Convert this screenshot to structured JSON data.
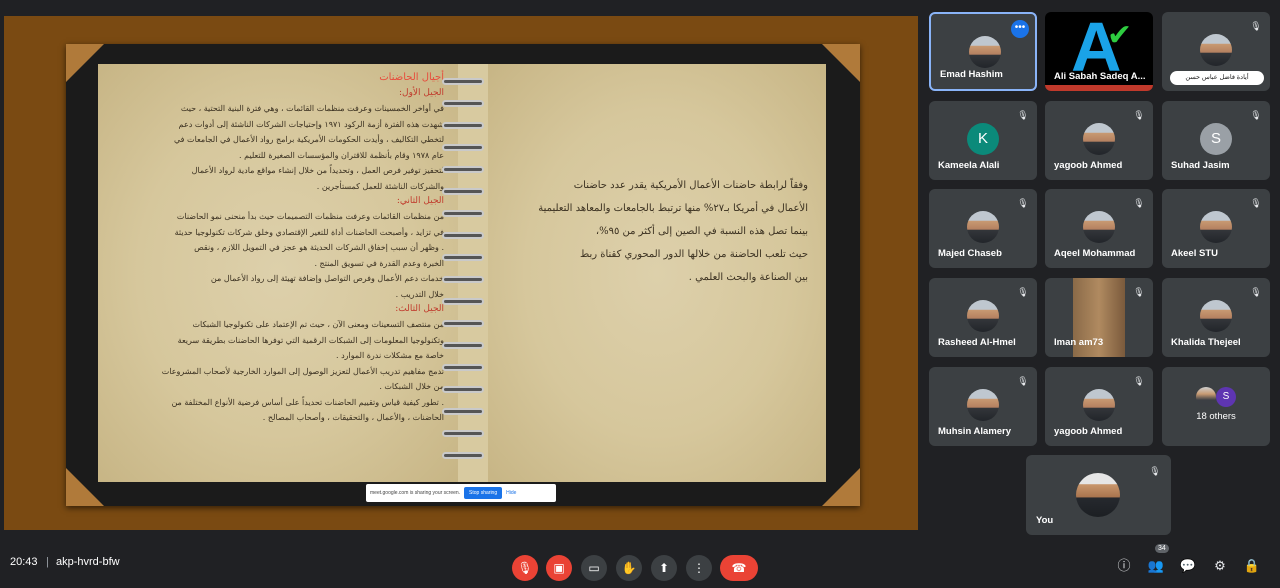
{
  "presentation": {
    "left_page": {
      "heading": "أجيال الحاضنات",
      "sections": [
        {
          "title": "الجيل الأول:",
          "lines": [
            "في أواخر الخمسينات وعرفت منظمات القائمات ، وهي فترة البنية التحتية ، حيث",
            "شهدت هذه الفترة أزمة الركود ١٩٧١ وإحتياجات الشركات الناشئة إلى أدوات دعم",
            "لتخطي التكاليف ، وأيدت الحكومات الأمريكية برامج رواد الأعمال في الجامعات في",
            "عام ١٩٧٨ وقام بأنظمة للاقتران والمؤسسات الصغيرة للتعليم .",
            "لتحفيز توفير فرص العمل ، وتحديداً من خلال إنشاء مواقع مادية لرواد الأعمال",
            "والشركات الناشئة للعمل كمستأجرين ."
          ]
        },
        {
          "title": "الجيل الثاني:",
          "lines": [
            "من منظمات القائمات وعرفت منظمات التصميمات حيث بدأ منحنى نمو الحاضنات",
            "في تزايد ، وأصبحت الحاضنات أداة للتغير الإقتصادي وخلق شركات تكنولوجيا حديثة",
            ". وظهر أن سبب إخفاق الشركات الحديثة هو عجز في التمويل اللازم ، ونقص",
            "الخبرة وعدم القدرة في تسويق المنتج .",
            "خدمات دعم الأعمال وفرص التواصل وإضافة تهيئة إلى رواد الأعمال من",
            "خلال التدريب ."
          ]
        },
        {
          "title": "الجيل الثالث:",
          "lines": [
            "من منتصف التسعينات ومعنى الآن ، حيث تم الإعتماد على تكنولوجيا الشبكات",
            "وتكنولوجيا المعلومات إلى الشبكات الرقمية التي توفرها الحاضنات بطريقة سريعة",
            "خاصة مع مشكلات ندرة الموارد .",
            "تدمج مفاهيم تدريب الأعمال لتعزيز الوصول إلى الموارد الخارجية لأصحاب المشروعات",
            "من خلال الشبكات .",
            ". تطور كيفية قياس وتقييم الحاضنات تحديداً على أساس فرضية الأنواع المختلفة من",
            "الحاضنات ، والأعمال ، والتحقيقات ، وأصحاب المصالح ."
          ]
        }
      ]
    },
    "right_page": {
      "lines": [
        "وفقاً لرابطة حاضنات الأعمال الأمريكية يقدر عدد حاضنات",
        "الأعمال في أمريكا بـ٢٧% منها ترتبط بالجامعات والمعاهد التعليمية",
        "بينما تصل هذه النسبة في الصين إلى أكثر من ٩٥%،",
        "حيث تلعب الحاضنة من خلالها الدور المحوري كقناة ربط",
        "بين الصناعة والبحث العلمي ."
      ]
    },
    "share_bar": {
      "message": "meet.google.com is sharing your screen.",
      "stop_label": "Stop sharing",
      "hide_label": "Hide"
    }
  },
  "participants": [
    {
      "name": "Emad Hashim"
    },
    {
      "name": "Ali Sabah Sadeq A..."
    },
    {
      "name": "أيادة فاضل عباس حسن"
    },
    {
      "name": "Kameela Alali",
      "initial": "K"
    },
    {
      "name": "yagoob Ahmed"
    },
    {
      "name": "Suhad Jasim",
      "initial": "S"
    },
    {
      "name": "Majed Chaseb"
    },
    {
      "name": "Aqeel Mohammad"
    },
    {
      "name": "Akeel STU"
    },
    {
      "name": "Rasheed Al-Hmel"
    },
    {
      "name": "Iman am73"
    },
    {
      "name": "Khalida Thejeel"
    },
    {
      "name": "Muhsin Alamery"
    },
    {
      "name": "yagoob Ahmed"
    },
    {
      "name": "18 others",
      "initial": "S"
    },
    {
      "name": "You"
    }
  ],
  "bottom_bar": {
    "time": "20:43",
    "separator": "|",
    "meeting_code": "akp-hvrd-bfw",
    "participant_count": "34"
  },
  "colors": {
    "end_call": "#ea4335",
    "active_border": "#8ab4f8",
    "background": "#202124"
  }
}
